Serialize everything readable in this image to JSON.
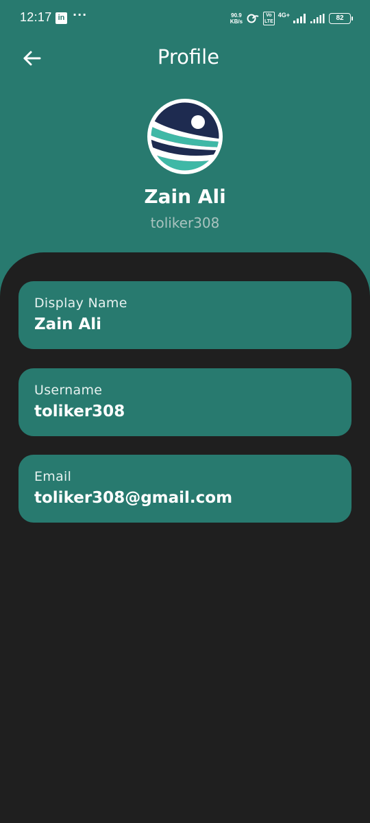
{
  "status_bar": {
    "time": "12:17",
    "linkedin_icon_letters": "in",
    "more_dots": "···",
    "net_speed_value": "90.9",
    "net_speed_unit": "KB/s",
    "volte_top": "Vo",
    "volte_bottom": "LTE",
    "network_type": "4G+",
    "battery_level": "82"
  },
  "app_bar": {
    "title": "Profile",
    "back_icon": "arrow-left-icon"
  },
  "profile": {
    "display_name": "Zain Ali",
    "username": "toliker308",
    "avatar_icon": "app-logo-avatar"
  },
  "fields": [
    {
      "label": "Display Name",
      "value": "Zain Ali"
    },
    {
      "label": "Username",
      "value": "toliker308"
    },
    {
      "label": "Email",
      "value": "toliker308@gmail.com"
    }
  ],
  "colors": {
    "primary": "#287a6f",
    "background": "#1f1f1f",
    "avatar_navy": "#1e2b50",
    "avatar_teal": "#3fb8a6",
    "username_muted": "#a9c3bf"
  }
}
